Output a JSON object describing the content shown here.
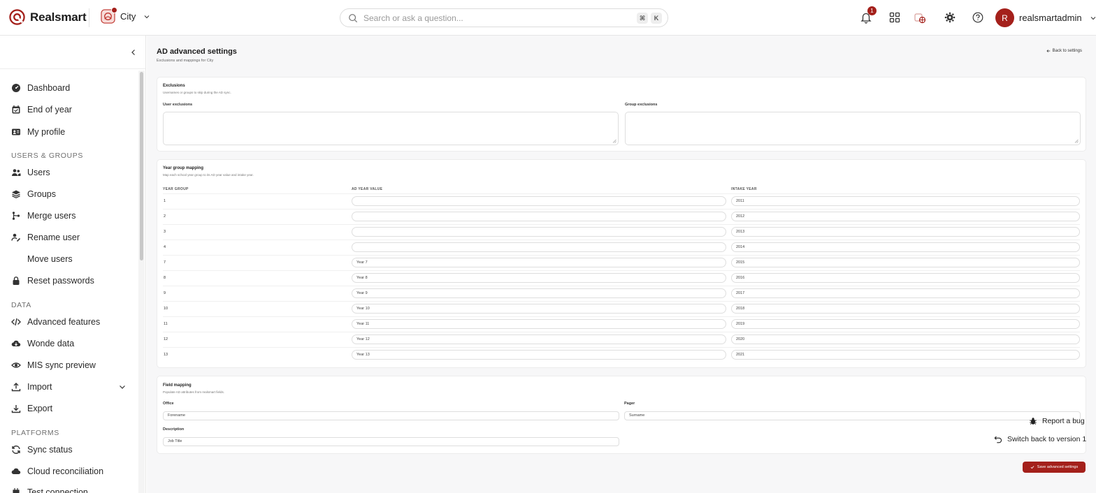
{
  "brand": {
    "name": "Realsmart",
    "accent": "#a4201b"
  },
  "school": {
    "name": "City"
  },
  "search": {
    "placeholder": "Search or ask a question...",
    "kbd1": "⌘",
    "kbd2": "K"
  },
  "notifications": {
    "count": "1"
  },
  "user": {
    "initial": "R",
    "name": "realsmartadmin"
  },
  "sidebar": {
    "items": [
      {
        "label": "Dashboard",
        "icon": "gauge-icon"
      },
      {
        "label": "End of year",
        "icon": "calendar-icon"
      },
      {
        "label": "My profile",
        "icon": "id-card-icon"
      }
    ],
    "section_users": "USERS & GROUPS",
    "users_items": [
      {
        "label": "Users",
        "icon": "users-icon"
      },
      {
        "label": "Groups",
        "icon": "layers-icon"
      },
      {
        "label": "Merge users",
        "icon": "merge-icon"
      },
      {
        "label": "Rename user",
        "icon": "rename-icon"
      },
      {
        "label": "Move users",
        "icon": ""
      },
      {
        "label": "Reset passwords",
        "icon": "lock-icon"
      }
    ],
    "section_data": "DATA",
    "data_items": [
      {
        "label": "Advanced features",
        "icon": "code-icon"
      },
      {
        "label": "Wonde data",
        "icon": "cloud-download-icon"
      },
      {
        "label": "MIS sync preview",
        "icon": "eye-icon"
      },
      {
        "label": "Import",
        "icon": "upload-icon"
      },
      {
        "label": "Export",
        "icon": "download-icon"
      }
    ],
    "section_platforms": "PLATFORMS",
    "platform_items": [
      {
        "label": "Sync status",
        "icon": "sync-icon"
      },
      {
        "label": "Cloud reconciliation",
        "icon": "cloud-icon"
      },
      {
        "label": "Test connection",
        "icon": "plug-icon"
      }
    ]
  },
  "page": {
    "title": "AD advanced settings",
    "subtitle": "Exclusions and mappings for City",
    "back_label": "Back to settings"
  },
  "exclusions": {
    "title": "Exclusions",
    "subtitle": "Usernames or groups to skip during the AD sync.",
    "user_label": "User exclusions",
    "group_label": "Group exclusions"
  },
  "year_mapping": {
    "title": "Year group mapping",
    "subtitle": "Map each school year group to its AD year value and intake year.",
    "headers": [
      "YEAR GROUP",
      "AD YEAR VALUE",
      "INTAKE YEAR"
    ],
    "rows": [
      {
        "group": "1",
        "ad": "",
        "intake": "2011"
      },
      {
        "group": "2",
        "ad": "",
        "intake": "2012"
      },
      {
        "group": "3",
        "ad": "",
        "intake": "2013"
      },
      {
        "group": "4",
        "ad": "",
        "intake": "2014"
      },
      {
        "group": "7",
        "ad": "Year 7",
        "intake": "2015"
      },
      {
        "group": "8",
        "ad": "Year 8",
        "intake": "2016"
      },
      {
        "group": "9",
        "ad": "Year 9",
        "intake": "2017"
      },
      {
        "group": "10",
        "ad": "Year 10",
        "intake": "2018"
      },
      {
        "group": "11",
        "ad": "Year 11",
        "intake": "2019"
      },
      {
        "group": "12",
        "ad": "Year 12",
        "intake": "2020"
      },
      {
        "group": "13",
        "ad": "Year 13",
        "intake": "2021"
      }
    ]
  },
  "field_mapping": {
    "title": "Field mapping",
    "subtitle": "Populate AD attributes from realsmart fields.",
    "office_label": "Office",
    "office_value": "Forename",
    "pager_label": "Pager",
    "pager_value": "Surname",
    "description_label": "Description",
    "description_value": "Job Title"
  },
  "save_label": "Save advanced settings",
  "report_bug": "Report a bug",
  "switch_version": "Switch back to version 1"
}
